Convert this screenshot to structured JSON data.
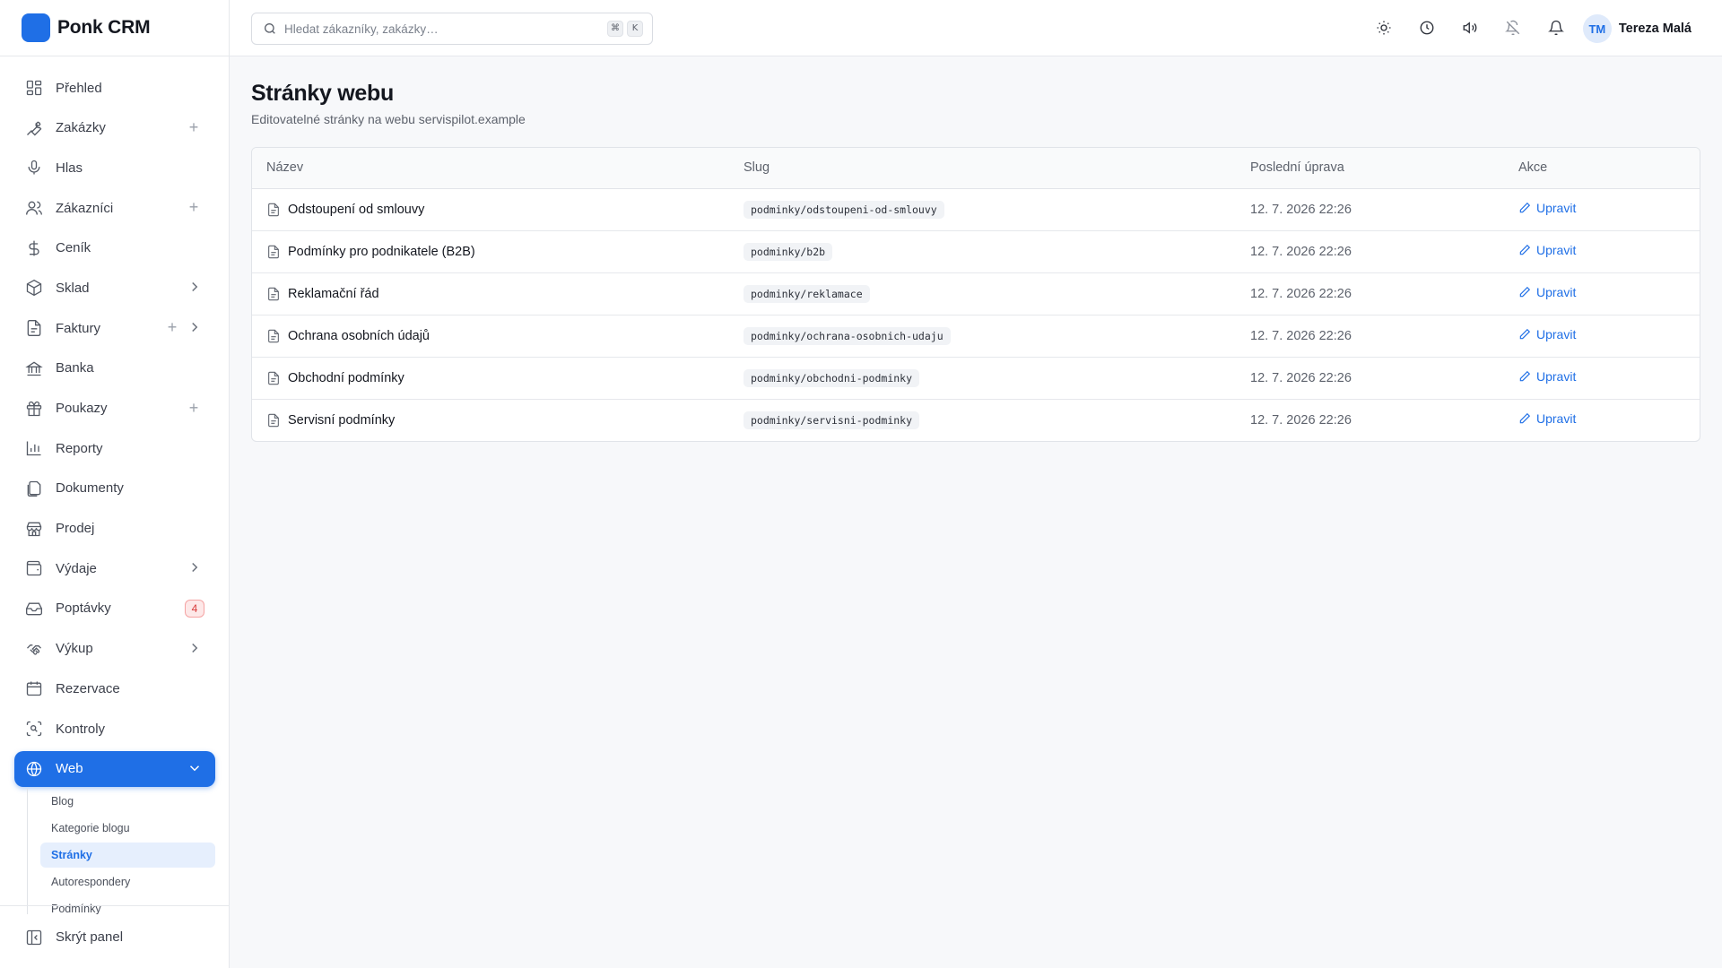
{
  "app": {
    "name": "Ponk CRM"
  },
  "search": {
    "placeholder": "Hledat zákazníky, zakázky…",
    "shortcut_1": "⌘",
    "shortcut_2": "K"
  },
  "user": {
    "initials": "TM",
    "name": "Tereza Malá"
  },
  "topbar_icons": [
    "sun-icon",
    "clock-icon",
    "speaker-icon",
    "bell-off-icon",
    "bell-icon"
  ],
  "sidebar": {
    "items": [
      {
        "label": "Přehled",
        "icon": "dashboard-icon"
      },
      {
        "label": "Zakázky",
        "icon": "wrench-icon",
        "plus": true
      },
      {
        "label": "Hlas",
        "icon": "microphone-icon"
      },
      {
        "label": "Zákazníci",
        "icon": "users-icon",
        "plus": true
      },
      {
        "label": "Ceník",
        "icon": "dollar-icon"
      },
      {
        "label": "Sklad",
        "icon": "package-icon",
        "chevron": true
      },
      {
        "label": "Faktury",
        "icon": "file-text-icon",
        "plus": true,
        "chevron": true
      },
      {
        "label": "Banka",
        "icon": "bank-icon"
      },
      {
        "label": "Poukazy",
        "icon": "gift-icon",
        "plus": true
      },
      {
        "label": "Reporty",
        "icon": "bar-chart-icon"
      },
      {
        "label": "Dokumenty",
        "icon": "documents-icon"
      },
      {
        "label": "Prodej",
        "icon": "store-icon"
      },
      {
        "label": "Výdaje",
        "icon": "wallet-icon",
        "chevron": true
      },
      {
        "label": "Poptávky",
        "icon": "inbox-icon",
        "badge": "4"
      },
      {
        "label": "Výkup",
        "icon": "handshake-icon",
        "chevron": true
      },
      {
        "label": "Rezervace",
        "icon": "calendar-icon"
      },
      {
        "label": "Kontroly",
        "icon": "scan-icon"
      },
      {
        "label": "Web",
        "icon": "globe-icon",
        "active": true,
        "expanded": true
      }
    ],
    "subitems": [
      "Blog",
      "Kategorie blogu",
      "Stránky",
      "Autorespondery",
      "Podmínky"
    ],
    "active_subitem": "Stránky",
    "footer_label": "Skrýt panel"
  },
  "page": {
    "title": "Stránky webu",
    "subtitle": "Editovatelné stránky na webu servispilot.example"
  },
  "table": {
    "columns": [
      "Název",
      "Slug",
      "Poslední úprava",
      "Akce"
    ],
    "rows": [
      {
        "name": "Odstoupení od smlouvy",
        "slug": "podminky/odstoupeni-od-smlouvy",
        "updated": "12. 7. 2026 22:26",
        "action": "Upravit"
      },
      {
        "name": "Podmínky pro podnikatele (B2B)",
        "slug": "podminky/b2b",
        "updated": "12. 7. 2026 22:26",
        "action": "Upravit"
      },
      {
        "name": "Reklamační řád",
        "slug": "podminky/reklamace",
        "updated": "12. 7. 2026 22:26",
        "action": "Upravit"
      },
      {
        "name": "Ochrana osobních údajů",
        "slug": "podminky/ochrana-osobnich-udaju",
        "updated": "12. 7. 2026 22:26",
        "action": "Upravit"
      },
      {
        "name": "Obchodní podmínky",
        "slug": "podminky/obchodni-podminky",
        "updated": "12. 7. 2026 22:26",
        "action": "Upravit"
      },
      {
        "name": "Servisní podmínky",
        "slug": "podminky/servisni-podminky",
        "updated": "12. 7. 2026 22:26",
        "action": "Upravit"
      }
    ]
  },
  "colors": {
    "accent": "#1f6fe6",
    "badge": "#d83a3a",
    "sidebar_bg": "#ffffff",
    "page_bg": "#f7f8fa"
  }
}
